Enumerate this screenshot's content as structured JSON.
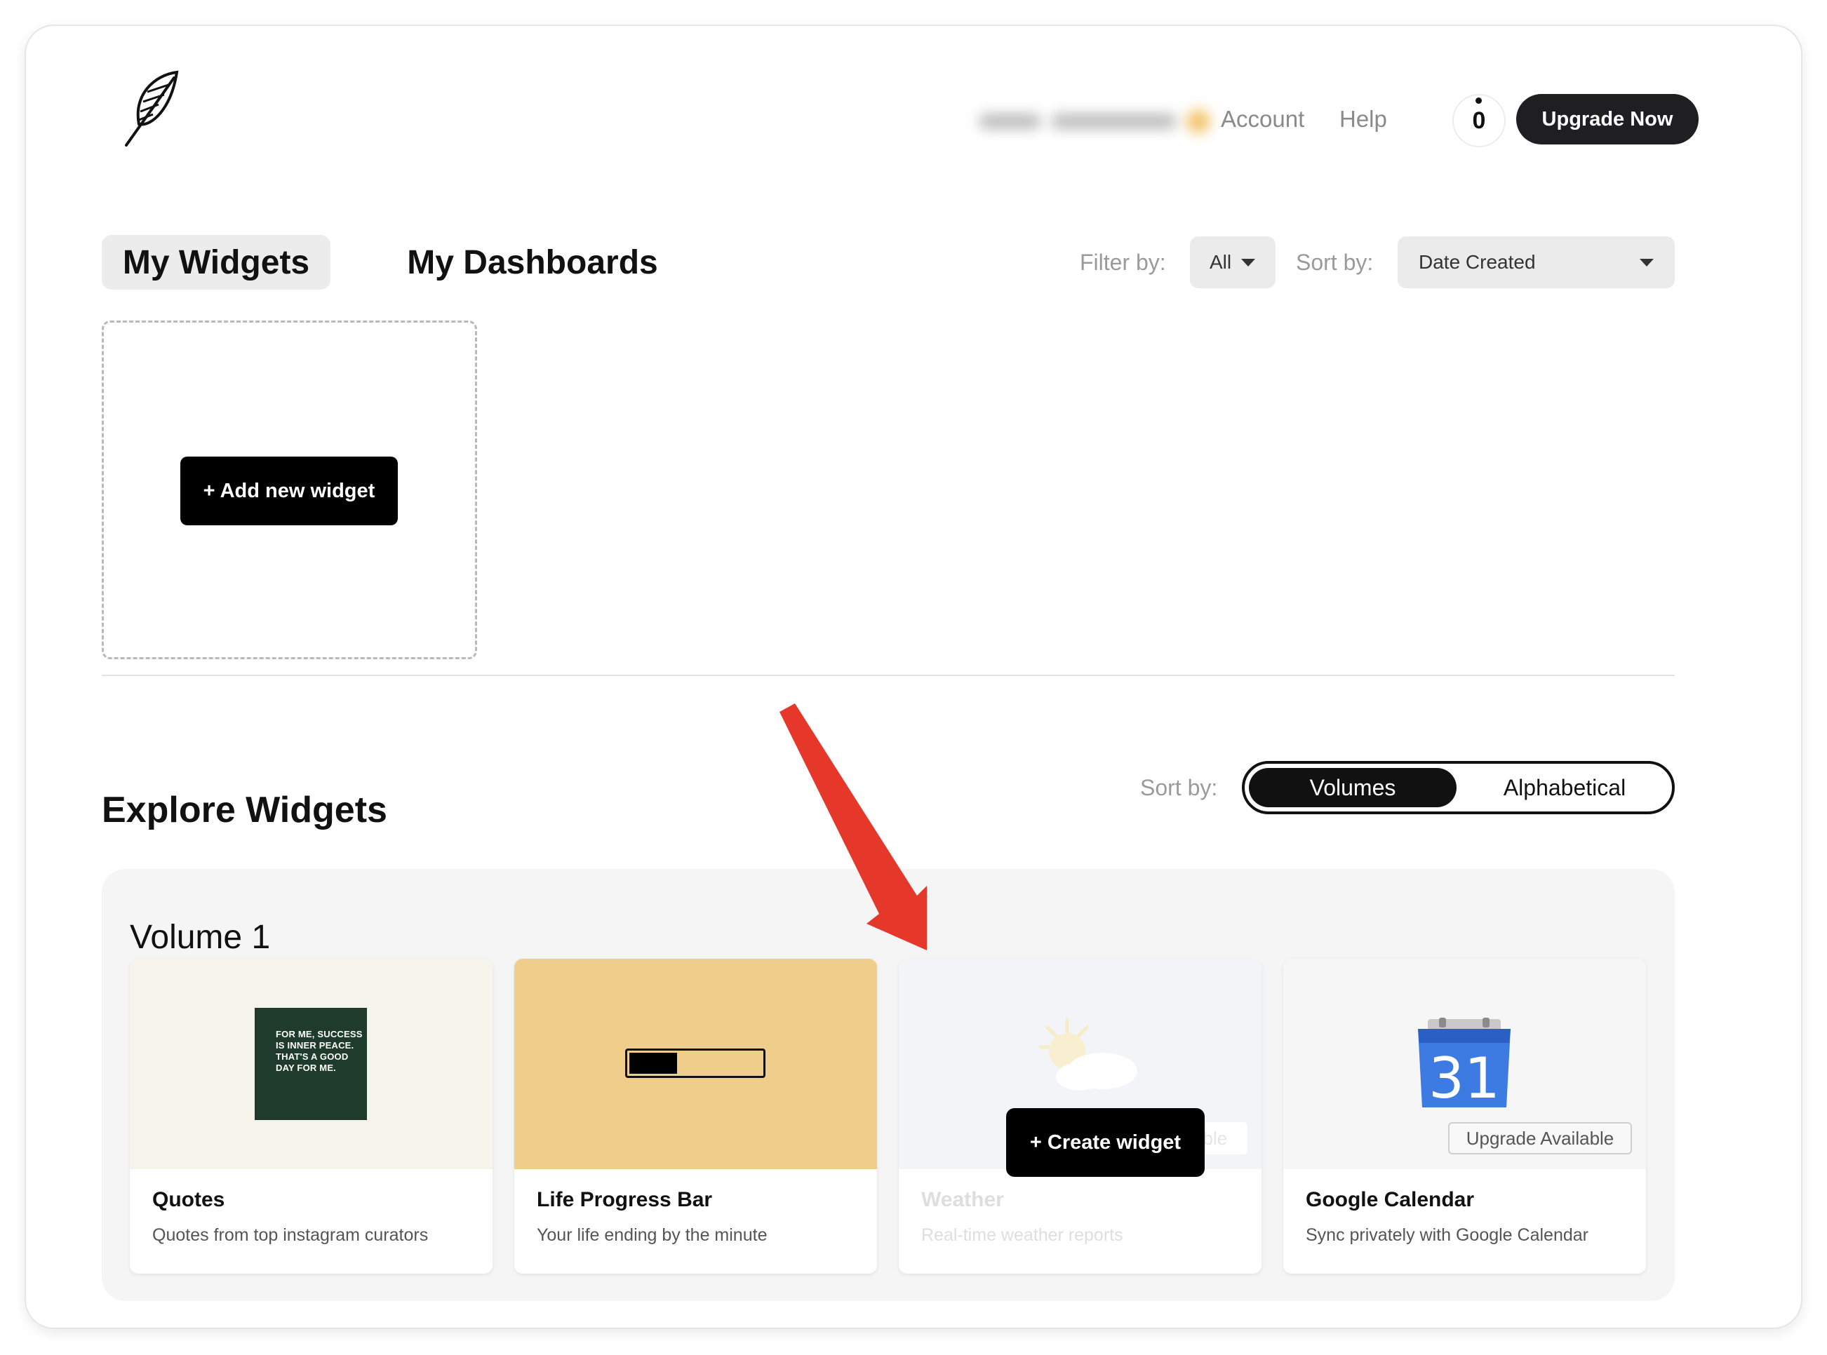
{
  "header": {
    "account_label": "Account",
    "help_label": "Help",
    "credits_count": "0",
    "upgrade_label": "Upgrade Now"
  },
  "tabs": [
    {
      "label": "My Widgets",
      "active": true
    },
    {
      "label": "My Dashboards",
      "active": false
    }
  ],
  "filters": {
    "filter_label": "Filter by:",
    "filter_value": "All",
    "sort_label": "Sort by:",
    "sort_value": "Date Created"
  },
  "my_widgets": {
    "add_label": "+ Add new widget"
  },
  "explore": {
    "title": "Explore Widgets",
    "sort_label": "Sort by:",
    "sort_options": [
      {
        "label": "Volumes",
        "active": true
      },
      {
        "label": "Alphabetical",
        "active": false
      }
    ],
    "volume_title": "Volume 1",
    "create_label": "+ Create widget",
    "cards": [
      {
        "title": "Quotes",
        "description": "Quotes from top instagram curators",
        "media_bg": "#f6f4ea",
        "preview_text": "FOR ME, SUCCESS IS INNER PEACE. THAT'S A GOOD DAY FOR ME."
      },
      {
        "title": "Life Progress Bar",
        "description": "Your life ending by the minute",
        "media_bg": "#efcd8b",
        "progress_fraction": 0.36
      },
      {
        "title": "Weather",
        "description": "Real-time weather reports",
        "media_bg": "#f2f4f7",
        "badge": "ailable",
        "state": "hover"
      },
      {
        "title": "Google Calendar",
        "description": "Sync privately with Google Calendar",
        "media_bg": "#f6f6f6",
        "calendar_day": "31",
        "badge": "Upgrade Available"
      }
    ]
  },
  "colors": {
    "accent_dark": "#1f1f21",
    "arrow": "#e5372a",
    "calendar_blue": "#2f6fdc"
  }
}
